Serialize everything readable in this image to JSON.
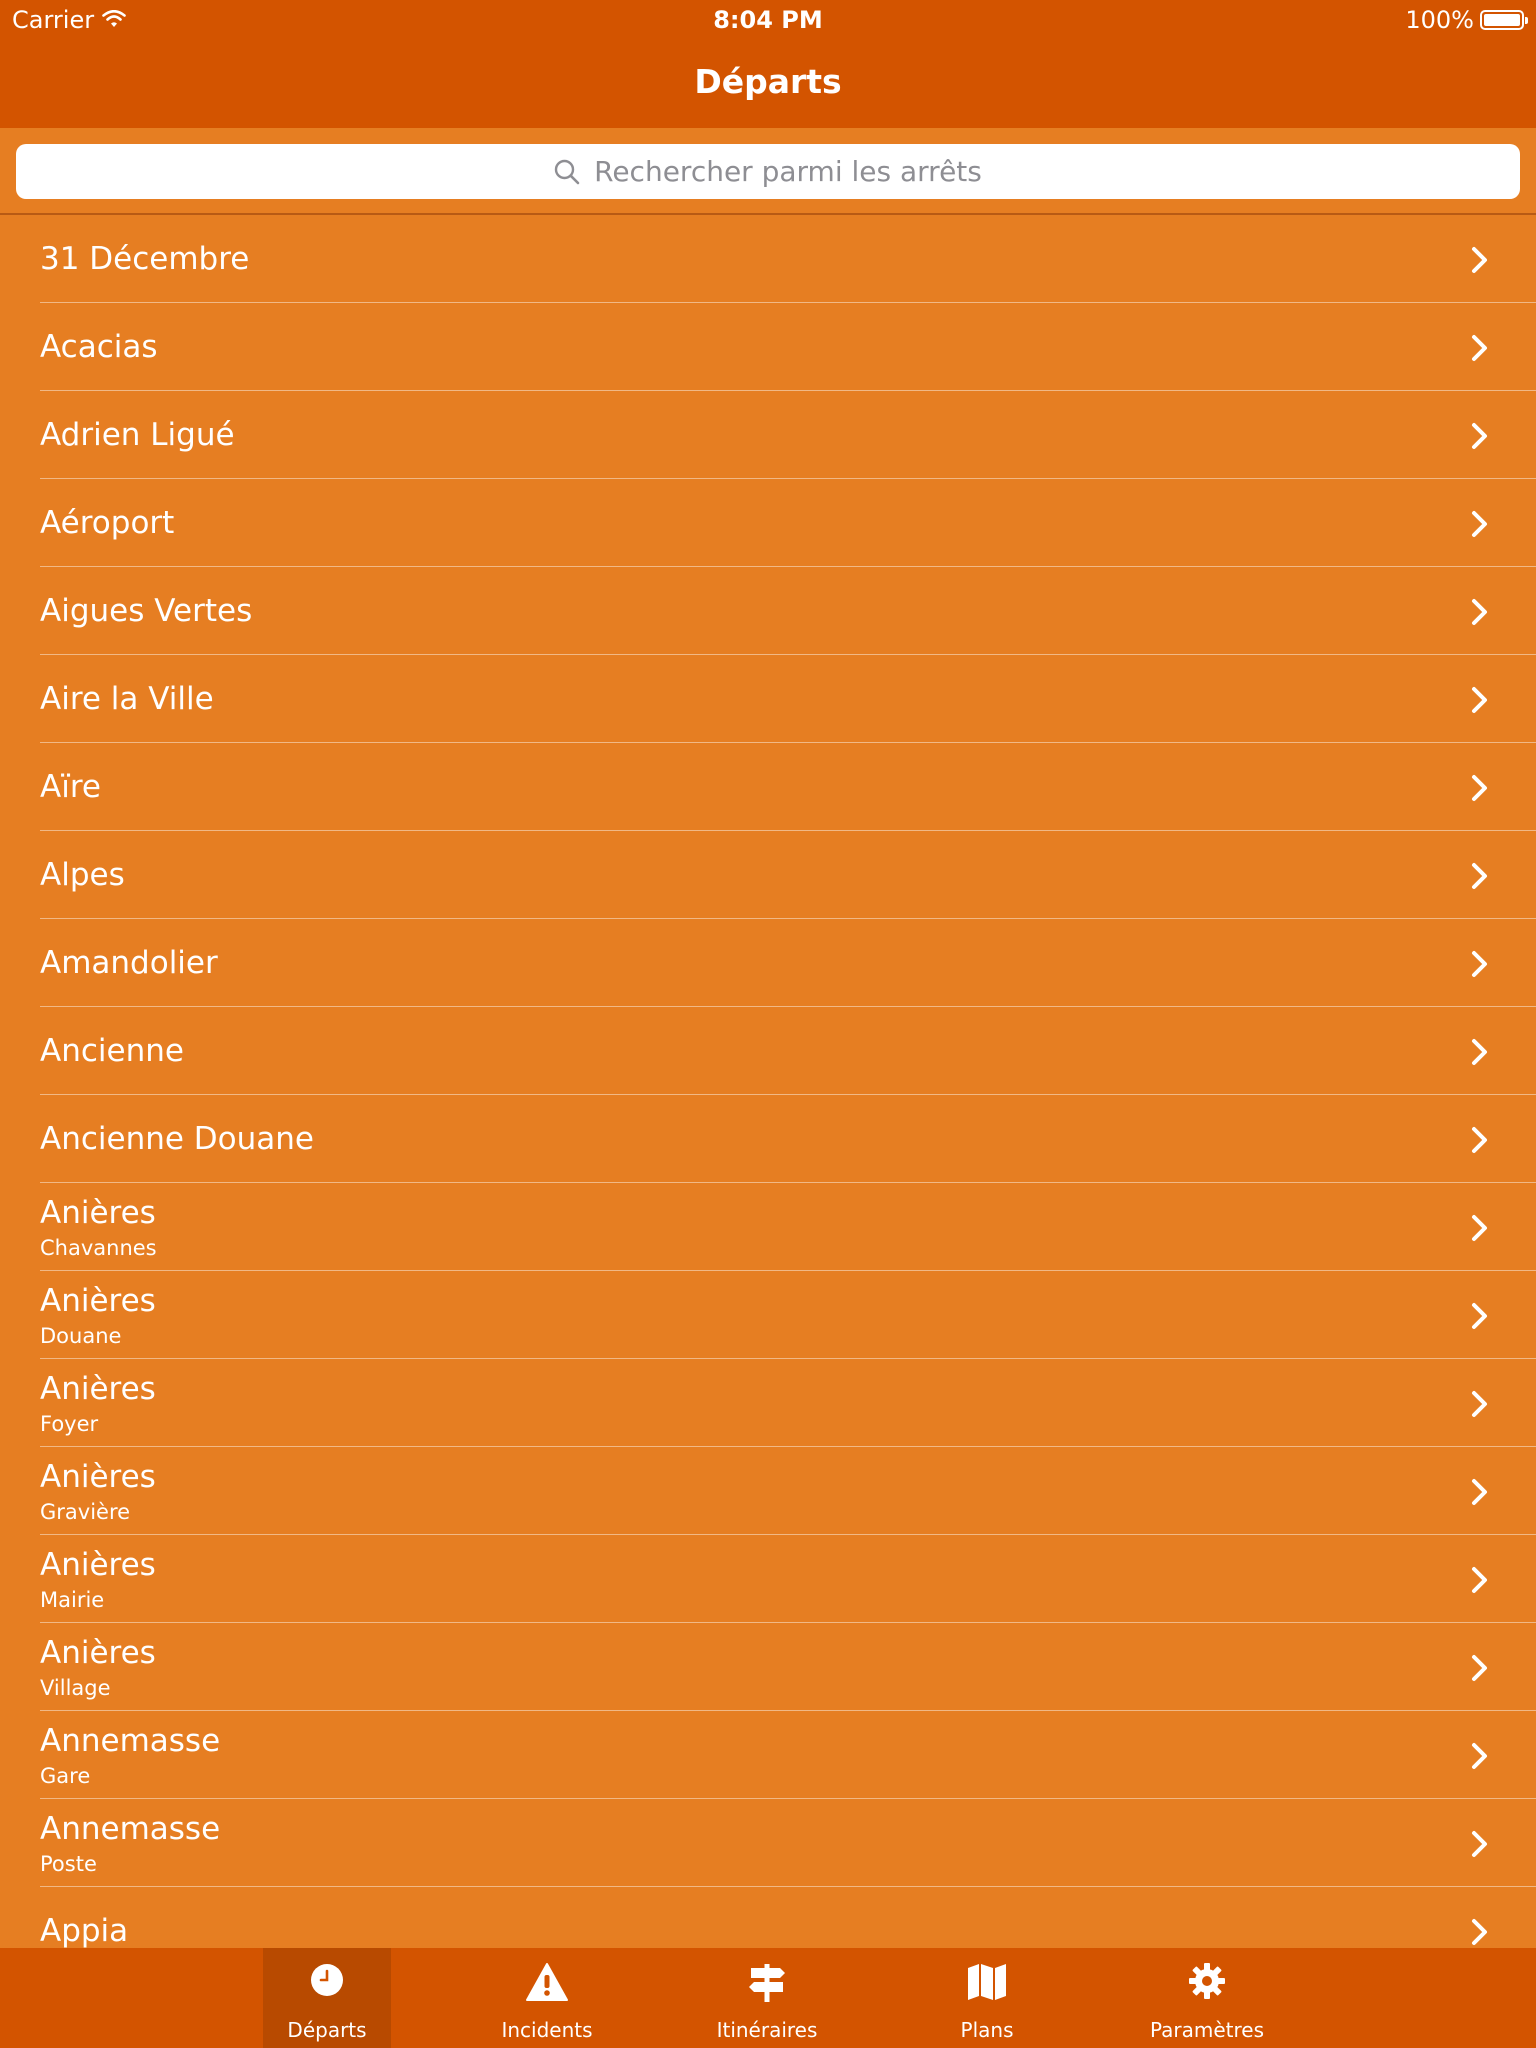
{
  "status_bar": {
    "carrier": "Carrier",
    "time": "8:04 PM",
    "battery": "100%"
  },
  "nav": {
    "title": "Départs"
  },
  "search": {
    "placeholder": "Rechercher parmi les arrêts"
  },
  "colors": {
    "bar": "#D35400",
    "background": "#E67E22",
    "active_tab": "#B84A00"
  },
  "stops": [
    {
      "title": "31 Décembre",
      "subtitle": ""
    },
    {
      "title": "Acacias",
      "subtitle": ""
    },
    {
      "title": "Adrien Ligué",
      "subtitle": ""
    },
    {
      "title": "Aéroport",
      "subtitle": ""
    },
    {
      "title": "Aigues Vertes",
      "subtitle": ""
    },
    {
      "title": "Aire la Ville",
      "subtitle": ""
    },
    {
      "title": "Aïre",
      "subtitle": ""
    },
    {
      "title": "Alpes",
      "subtitle": ""
    },
    {
      "title": "Amandolier",
      "subtitle": ""
    },
    {
      "title": "Ancienne",
      "subtitle": ""
    },
    {
      "title": "Ancienne Douane",
      "subtitle": ""
    },
    {
      "title": "Anières",
      "subtitle": "Chavannes"
    },
    {
      "title": "Anières",
      "subtitle": "Douane"
    },
    {
      "title": "Anières",
      "subtitle": "Foyer"
    },
    {
      "title": "Anières",
      "subtitle": "Gravière"
    },
    {
      "title": "Anières",
      "subtitle": "Mairie"
    },
    {
      "title": "Anières",
      "subtitle": "Village"
    },
    {
      "title": "Annemasse",
      "subtitle": "Gare"
    },
    {
      "title": "Annemasse",
      "subtitle": "Poste"
    },
    {
      "title": "Appia",
      "subtitle": ""
    }
  ],
  "tabs": [
    {
      "label": "Départs",
      "icon": "clock-icon",
      "active": true
    },
    {
      "label": "Incidents",
      "icon": "warning-icon",
      "active": false
    },
    {
      "label": "Itinéraires",
      "icon": "signpost-icon",
      "active": false
    },
    {
      "label": "Plans",
      "icon": "map-icon",
      "active": false
    },
    {
      "label": "Paramètres",
      "icon": "gear-icon",
      "active": false
    }
  ]
}
